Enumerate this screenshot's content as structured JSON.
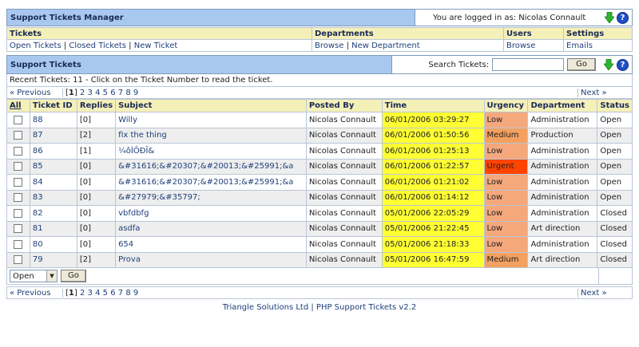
{
  "header": {
    "title": "Support Tickets Manager",
    "login_text": "You are logged in as: Nicolas Connault"
  },
  "menu": {
    "tickets": {
      "heading": "Tickets",
      "links": [
        "Open Tickets",
        "Closed Tickets",
        "New Ticket"
      ]
    },
    "departments": {
      "heading": "Departments",
      "links": [
        "Browse",
        "New Department"
      ]
    },
    "users": {
      "heading": "Users",
      "links": [
        "Browse"
      ]
    },
    "settings": {
      "heading": "Settings",
      "links": [
        "Emails"
      ]
    }
  },
  "section": {
    "title": "Support Tickets",
    "search_label": "Search Tickets:",
    "search_value": "",
    "go_label": "Go"
  },
  "info": "Recent Tickets: 11 - Click on the Ticket Number to read the ticket.",
  "pager": {
    "previous": "« Previous",
    "current": "1",
    "pages": [
      "2",
      "3",
      "4",
      "5",
      "6",
      "7",
      "8",
      "9"
    ],
    "next": "Next »"
  },
  "columns": [
    "All",
    "Ticket ID",
    "Replies",
    "Subject",
    "Posted By",
    "Time",
    "Urgency",
    "Department",
    "Status"
  ],
  "rows": [
    {
      "id": "88",
      "replies": "[0]",
      "subject": "Willy",
      "posted_by": "Nicolas Connault",
      "time": "06/01/2006 03:29:27",
      "urgency": "Low",
      "department": "Administration",
      "status": "Open"
    },
    {
      "id": "87",
      "replies": "[2]",
      "subject": "fix the thing",
      "posted_by": "Nicolas Connault",
      "time": "06/01/2006 01:50:56",
      "urgency": "Medium",
      "department": "Production",
      "status": "Open"
    },
    {
      "id": "86",
      "replies": "[1]",
      "subject": "¼ôÌÔĐĪ&",
      "posted_by": "Nicolas Connault",
      "time": "06/01/2006 01:25:13",
      "urgency": "Low",
      "department": "Administration",
      "status": "Open"
    },
    {
      "id": "85",
      "replies": "[0]",
      "subject": "&#31616;&#20307;&#20013;&#25991;&a",
      "posted_by": "Nicolas Connault",
      "time": "06/01/2006 01:22:57",
      "urgency": "Urgent",
      "department": "Administration",
      "status": "Open"
    },
    {
      "id": "84",
      "replies": "[0]",
      "subject": "&#31616;&#20307;&#20013;&#25991;&a",
      "posted_by": "Nicolas Connault",
      "time": "06/01/2006 01:21:02",
      "urgency": "Low",
      "department": "Administration",
      "status": "Open"
    },
    {
      "id": "83",
      "replies": "[0]",
      "subject": "&#27979;&#35797;",
      "posted_by": "Nicolas Connault",
      "time": "06/01/2006 01:14:12",
      "urgency": "Low",
      "department": "Administration",
      "status": "Open"
    },
    {
      "id": "82",
      "replies": "[0]",
      "subject": "vbfdbfg",
      "posted_by": "Nicolas Connault",
      "time": "05/01/2006 22:05:29",
      "urgency": "Low",
      "department": "Administration",
      "status": "Closed"
    },
    {
      "id": "81",
      "replies": "[0]",
      "subject": "asdfa",
      "posted_by": "Nicolas Connault",
      "time": "05/01/2006 21:22:45",
      "urgency": "Low",
      "department": "Art direction",
      "status": "Closed"
    },
    {
      "id": "80",
      "replies": "[0]",
      "subject": "654",
      "posted_by": "Nicolas Connault",
      "time": "05/01/2006 21:18:33",
      "urgency": "Low",
      "department": "Administration",
      "status": "Closed"
    },
    {
      "id": "79",
      "replies": "[2]",
      "subject": "Prova",
      "posted_by": "Nicolas Connault",
      "time": "05/01/2006 16:47:59",
      "urgency": "Medium",
      "department": "Art direction",
      "status": "Closed"
    }
  ],
  "bulk": {
    "select_value": "Open",
    "go_label": "Go"
  },
  "footer": "Triangle Solutions Ltd | PHP Support Tickets v2.2",
  "colors": {
    "header_bg": "#a8c8f0",
    "menu_bg": "#f5f0b8",
    "time_bg": "#ffff33",
    "urgent_bg": "#ff4400",
    "low_bg": "#f4a87c"
  }
}
